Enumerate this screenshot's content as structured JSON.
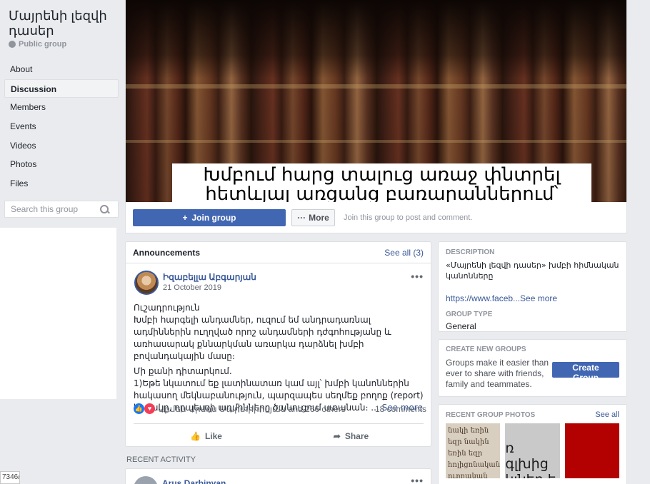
{
  "group": {
    "name": "Մայրենի լեզվի դասեր",
    "privacy": "Public group"
  },
  "nav": [
    {
      "label": "About"
    },
    {
      "label": "Discussion",
      "active": true
    },
    {
      "label": "Members"
    },
    {
      "label": "Events"
    },
    {
      "label": "Videos"
    },
    {
      "label": "Photos"
    },
    {
      "label": "Files"
    }
  ],
  "search": {
    "placeholder": "Search this group"
  },
  "statusbar": {
    "text": "7346/"
  },
  "cover": {
    "caption": "Խմբում հարց տալուց առաջ փնտրել հետևյալ առցանց բառարաններում՝"
  },
  "cover_actions": {
    "join_label": "Join group",
    "more_label": "More",
    "hint": "Join this group to post and comment."
  },
  "announcements": {
    "title": "Announcements",
    "see_all": "See all (3)",
    "post": {
      "author": "Իզաբելլա Աբգարյան",
      "date": "21 October 2019",
      "p1_title": "Ուշադրություն",
      "p1_body": "Խմբի հարգելի անդամներ, ուզում եմ անդրադառնալ ադմիններին ուղղված որոշ անդամների դժգոհությանը և առհասարակ քննարկման առարկա դարձնել խմբի բովանդակային մասը։",
      "p2_title": "Մի քանի դիտարկում.",
      "p2_body": "1)Եթե նկատում եք լատինատառ կամ այլ՝ խմբի կանոններին հակասող մեկնաբանություն, պարզապես սեղմեք բողոք (report) կոճակը, որպեսզի ադմինները ծանուցում ստանան։ ...",
      "see_more": "See more",
      "reactions_text": "Արմեն Արմոս Մարտիրոսյան and 266 others",
      "comments": "18 comments",
      "like": "Like",
      "share": "Share"
    }
  },
  "recent_activity": {
    "label": "RECENT ACTIVITY",
    "author": "Arus Darbinyan"
  },
  "description": {
    "title": "DESCRIPTION",
    "text": "«Մայրենի լեզվի դասեր» խմբի հիմնական կանոնները",
    "url": "https://www.faceb...",
    "see_more": "See more",
    "type_title": "GROUP TYPE",
    "type_value": "General"
  },
  "create_groups": {
    "title": "CREATE NEW GROUPS",
    "text": "Groups make it easier than ever to share with friends, family and teammates.",
    "button": "Create Group"
  },
  "photos": {
    "title": "RECENT GROUP PHOTOS",
    "see_all": "See all",
    "thumb1_text": "նակի եռին եզր նակին եռին եզր հոլիցոնական ուղղական եռանկ",
    "thumb2_text": "ռ գլխից կյներ ե"
  },
  "colors": {
    "accent": "#4267b2",
    "link": "#385898",
    "background": "#e9ebee"
  }
}
